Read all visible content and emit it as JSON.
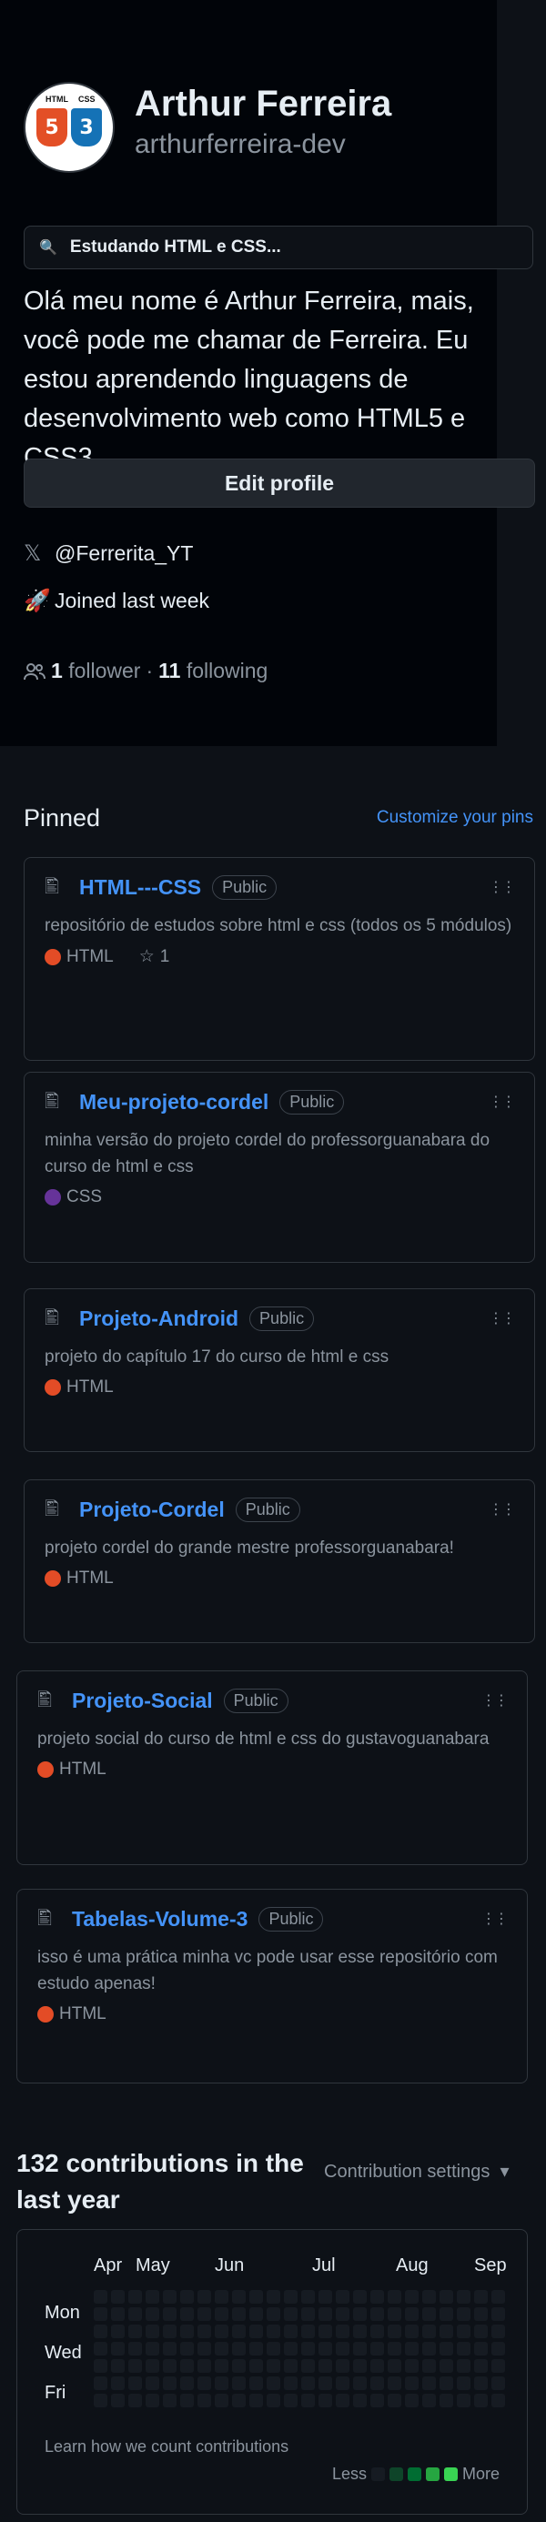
{
  "profile": {
    "name": "Arthur Ferreira",
    "username": "arthurferreira-dev",
    "avatar_badges": [
      "5",
      "3"
    ],
    "avatar_tags": [
      "HTML",
      "CSS"
    ],
    "status": "Estudando HTML e CSS...",
    "bio": "Olá meu nome é Arthur Ferreira, mais, você pode me chamar de Ferreira. Eu estou aprendendo linguagens de desenvolvimento web como HTML5 e CSS3.",
    "edit_label": "Edit profile",
    "twitter": "@Ferrerita_YT",
    "joined": "Joined last week",
    "followers_count": "1",
    "followers_label": "follower",
    "separator": "·",
    "following_count": "11",
    "following_label": "following"
  },
  "pinned": {
    "title": "Pinned",
    "customize": "Customize your pins",
    "repos": [
      {
        "name": "HTML---CSS",
        "visibility": "Public",
        "description": "repositório de estudos sobre html e css (todos os 5 módulos)",
        "language": "HTML",
        "lang_color": "#e34c26",
        "stars": "1"
      },
      {
        "name": "Meu-projeto-cordel",
        "visibility": "Public",
        "description": "minha versão do projeto cordel do professorguanabara do curso de html e css",
        "language": "CSS",
        "lang_color": "#663399"
      },
      {
        "name": "Projeto-Android",
        "visibility": "Public",
        "description": "projeto do capítulo 17 do curso de html e css",
        "language": "HTML",
        "lang_color": "#e34c26"
      },
      {
        "name": "Projeto-Cordel",
        "visibility": "Public",
        "description": "projeto cordel do grande mestre professorguanabara!",
        "language": "HTML",
        "lang_color": "#e34c26"
      },
      {
        "name": "Projeto-Social",
        "visibility": "Public",
        "description": "projeto social do curso de html e css do gustavoguanabara",
        "language": "HTML",
        "lang_color": "#e34c26"
      },
      {
        "name": "Tabelas-Volume-3",
        "visibility": "Public",
        "description": "isso é uma prática minha vc pode usar esse repositório com estudo apenas!",
        "language": "HTML",
        "lang_color": "#e34c26"
      }
    ]
  },
  "contributions": {
    "title": "132 contributions in the last year",
    "settings": "Contribution settings",
    "months": [
      "Apr",
      "May",
      "Jun",
      "Jul",
      "Aug",
      "Sep"
    ],
    "days": [
      "Mon",
      "Wed",
      "Fri"
    ],
    "learn": "Learn how we count contributions",
    "legend_less": "Less",
    "legend_more": "More",
    "legend_colors": [
      "#161b22",
      "#0e4429",
      "#006d32",
      "#26a641",
      "#39d353"
    ]
  }
}
